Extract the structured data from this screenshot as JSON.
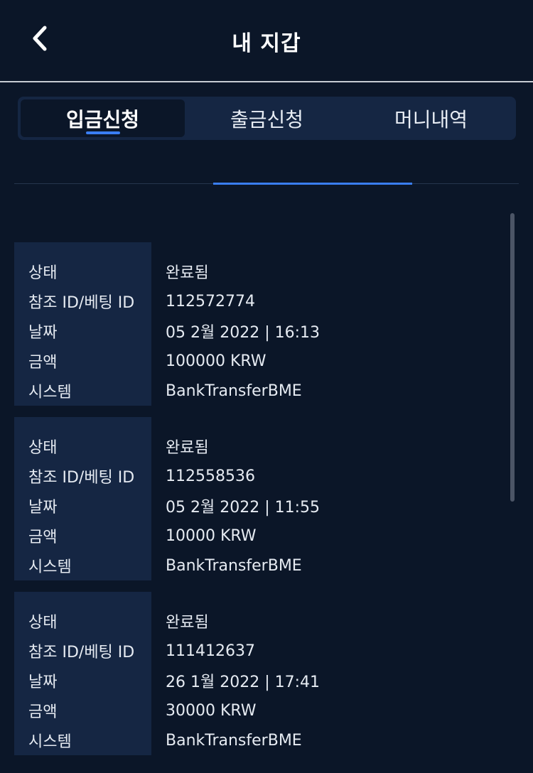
{
  "header": {
    "title": "내 지갑",
    "back_icon": "chevron-left-icon"
  },
  "tabs": [
    {
      "label": "입금신청",
      "active": true
    },
    {
      "label": "출금신청",
      "active": false
    },
    {
      "label": "머니내역",
      "active": false
    }
  ],
  "colors": {
    "background": "#0b1628",
    "panel": "#152643",
    "accent": "#3a7ef3"
  },
  "records": [
    {
      "rows": [
        {
          "label": "상태",
          "value": "완료됨"
        },
        {
          "label": "참조 ID/베팅 ID",
          "value": "112572774"
        },
        {
          "label": "날짜",
          "value": "05 2월 2022 | 16:13"
        },
        {
          "label": "금액",
          "value": "100000 KRW"
        },
        {
          "label": "시스템",
          "value": "BankTransferBME"
        }
      ]
    },
    {
      "rows": [
        {
          "label": "상태",
          "value": "완료됨"
        },
        {
          "label": "참조 ID/베팅 ID",
          "value": "112558536"
        },
        {
          "label": "날짜",
          "value": "05 2월 2022 | 11:55"
        },
        {
          "label": "금액",
          "value": "10000 KRW"
        },
        {
          "label": "시스템",
          "value": "BankTransferBME"
        }
      ]
    },
    {
      "rows": [
        {
          "label": "상태",
          "value": "완료됨"
        },
        {
          "label": "참조 ID/베팅 ID",
          "value": "111412637"
        },
        {
          "label": "날짜",
          "value": "26 1월 2022 | 17:41"
        },
        {
          "label": "금액",
          "value": "30000 KRW"
        },
        {
          "label": "시스템",
          "value": "BankTransferBME"
        }
      ]
    }
  ]
}
